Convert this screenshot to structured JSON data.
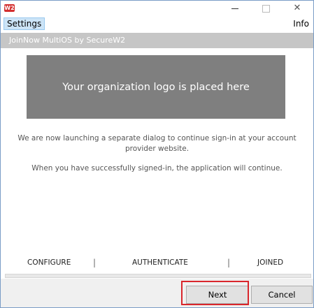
{
  "app": {
    "icon_text": "W2",
    "window_controls": {
      "minimize": "—",
      "maximize": "☐",
      "close": "✕"
    }
  },
  "menu": {
    "settings": "Settings",
    "info": "Info"
  },
  "header": {
    "title": "JoinNow MultiOS by SecureW2"
  },
  "logo": {
    "placeholder": "Your organization logo is placed here"
  },
  "messages": {
    "line1a": "We are now launching a separate dialog to continue sign-in at your account",
    "line1b": "provider website.",
    "line2": "When you have successfully signed-in, the application will continue."
  },
  "steps": {
    "configure": "CONFIGURE",
    "authenticate": "AUTHENTICATE",
    "joined": "JOINED",
    "separator": "|"
  },
  "buttons": {
    "next": "Next",
    "cancel": "Cancel"
  },
  "colors": {
    "header_strip": "#c6c6c6",
    "logo_bg": "#7f7f7f",
    "highlight": "#d9262c",
    "menu_selected": "#cce4f7"
  }
}
